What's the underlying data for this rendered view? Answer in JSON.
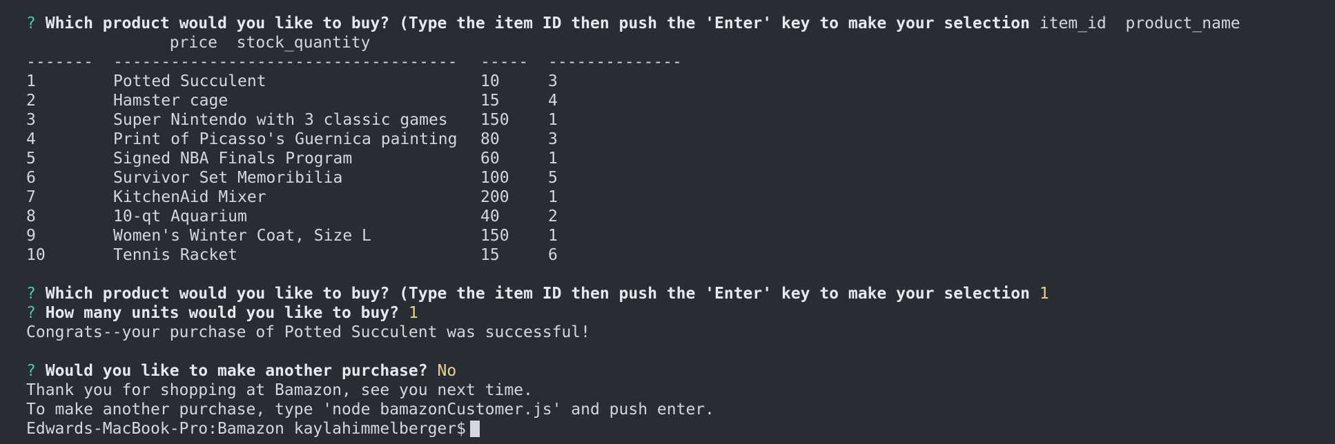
{
  "terminal": {
    "prompt_symbol": "?",
    "question1": "Which product would you like to buy? (Type the item ID then push the 'Enter' key to make your selection",
    "header_wrap_line1": "item_id  product_name",
    "header_wrap_line2": "               price  stock_quantity",
    "separators": {
      "col1": "-------",
      "col2": "------------------------------------",
      "col3": "-----",
      "col4": "--------------"
    },
    "rows": [
      {
        "id": "1",
        "name": "Potted Succulent",
        "price": "10",
        "qty": "3"
      },
      {
        "id": "2",
        "name": "Hamster cage",
        "price": "15",
        "qty": "4"
      },
      {
        "id": "3",
        "name": "Super Nintendo with 3 classic games",
        "price": "150",
        "qty": "1"
      },
      {
        "id": "4",
        "name": "Print of Picasso's Guernica painting",
        "price": "80",
        "qty": "3"
      },
      {
        "id": "5",
        "name": "Signed NBA Finals Program",
        "price": "60",
        "qty": "1"
      },
      {
        "id": "6",
        "name": "Survivor Set Memoribilia",
        "price": "100",
        "qty": "5"
      },
      {
        "id": "7",
        "name": "KitchenAid Mixer",
        "price": "200",
        "qty": "1"
      },
      {
        "id": "8",
        "name": "10-qt Aquarium",
        "price": "40",
        "qty": "2"
      },
      {
        "id": "9",
        "name": "Women's Winter Coat, Size L",
        "price": "150",
        "qty": "1"
      },
      {
        "id": "10",
        "name": "Tennis Racket",
        "price": "15",
        "qty": "6"
      }
    ],
    "answer1": "1",
    "question2": "How many units would you like to buy?",
    "answer2": "1",
    "congrats": "Congrats--your purchase of Potted Succulent was successful!",
    "question3": "Would you like to make another purchase?",
    "answer3": "No",
    "thanks": "Thank you for shopping at Bamazon, see you next time.",
    "instructions": "To make another purchase, type 'node bamazonCustomer.js' and push enter.",
    "shell_prompt": "Edwards-MacBook-Pro:Bamazon kaylahimmelberger$"
  }
}
